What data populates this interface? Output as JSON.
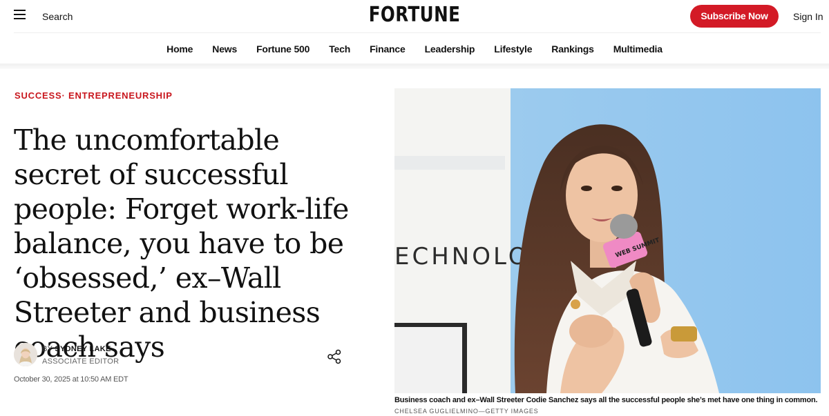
{
  "header": {
    "search_label": "Search",
    "logo": "FORTUNE",
    "subscribe_label": "Subscribe Now",
    "signin_label": "Sign In"
  },
  "nav": {
    "items": [
      "Home",
      "News",
      "Fortune 500",
      "Tech",
      "Finance",
      "Leadership",
      "Lifestyle",
      "Rankings",
      "Multimedia"
    ]
  },
  "article": {
    "category": "SUCCESS· ENTREPRENEURSHIP",
    "headline": "The uncomfortable secret of successful people: Forget work-life balance, you have to be ‘obsessed,’ ex–Wall Streeter and business coach says",
    "byline_prefix": "BY",
    "author": "SYDNEY LAKE",
    "author_title": "ASSOCIATE EDITOR",
    "timestamp": "October 30, 2025 at 10:50 AM EDT",
    "image": {
      "backdrop_text": "ECHNOLOGY",
      "mic_flag_text": "WEB SUMMIT"
    },
    "caption": "Business coach and ex–Wall Streeter Codie Sanchez says all the successful people she’s met have one thing in common.",
    "credit": "CHELSEA GUGLIELMINO—GETTY IMAGES"
  },
  "colors": {
    "brand_red": "#d31a26",
    "category_red": "#c8161d",
    "text": "#111111"
  },
  "icons": {
    "menu": "hamburger-icon",
    "share": "share-icon"
  }
}
